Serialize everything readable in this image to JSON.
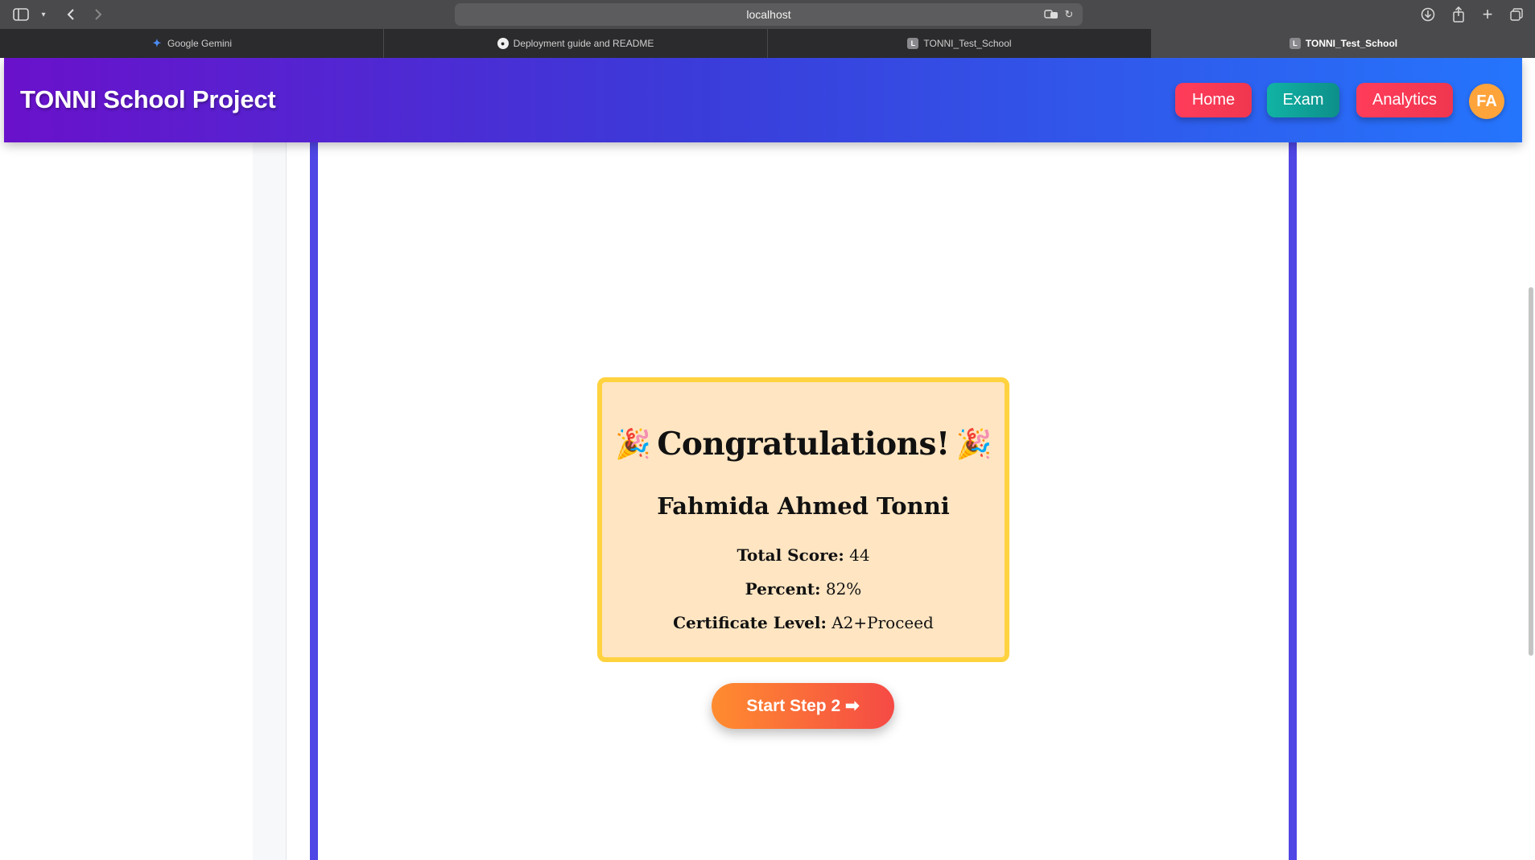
{
  "browser": {
    "address": "localhost",
    "tabs": [
      {
        "label": "Google Gemini",
        "icon": "gemini-icon"
      },
      {
        "label": "Deployment guide and README",
        "icon": "github-icon"
      },
      {
        "label": "TONNI_Test_School",
        "icon": "letter-l-icon"
      },
      {
        "label": "TONNI_Test_School",
        "icon": "letter-l-icon",
        "active": true
      }
    ],
    "fav_letter": "L"
  },
  "navbar": {
    "brand": "TONNI School Project",
    "links": [
      "Home",
      "Exam",
      "Analytics"
    ],
    "avatar_initials": "FA",
    "colors": {
      "gradient_start": "#6a11cb",
      "gradient_end": "#2575fc",
      "home": "#f0364f",
      "exam": "#0d8f8a",
      "analytics": "#f0364f",
      "avatar": "#ffa43a"
    }
  },
  "result": {
    "title": "Congratulations!",
    "party_emoji": "🎉",
    "student_name": "Fahmida Ahmed Tonni",
    "total_score_label": "Total Score:",
    "total_score": "44",
    "percent_label": "Percent:",
    "percent": "82%",
    "certificate_label": "Certificate Level:",
    "certificate": "A2+Proceed",
    "next_button": "Start Step 2 ➡"
  }
}
